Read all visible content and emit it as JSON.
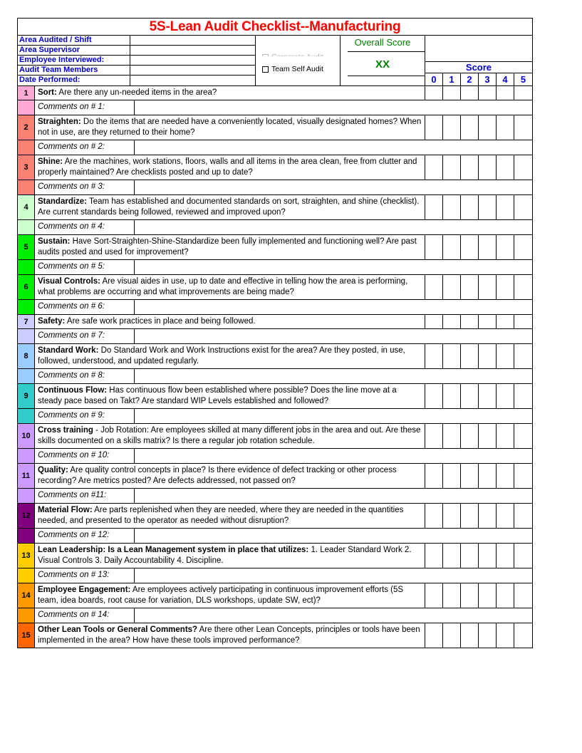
{
  "title": "5S-Lean Audit Checklist--Manufacturing",
  "header": {
    "fields": [
      {
        "label": "Area Audited / Shift",
        "value": ""
      },
      {
        "label": "Area Supervisor",
        "value": ""
      },
      {
        "label": "Employee Interviewed:",
        "value": ""
      },
      {
        "label": "Audit Team Members",
        "value": ""
      },
      {
        "label": "Date Performed:",
        "value": ""
      }
    ],
    "checkboxes": [
      {
        "label": "Corporate Audit",
        "checked": false
      },
      {
        "label": "Team Self Audit",
        "checked": false
      }
    ],
    "overall_score_label": "Overall Score",
    "overall_score_value": "XX",
    "score_word": "Score",
    "score_columns": [
      "0",
      "1",
      "2",
      "3",
      "4",
      "5"
    ]
  },
  "colors": {
    "title": "#FF0000",
    "header_label": "#0000CC",
    "score_header": "#0000CC",
    "overall_score": "#008000",
    "border": "#000000"
  },
  "items": [
    {
      "num": "1",
      "color": "#FFAAD4",
      "bold": "Sort:",
      "text": "  Are there any un-needed items in the area?",
      "comment_label": "Comments on # 1:",
      "comment_value": ""
    },
    {
      "num": "2",
      "color": "#FA8072",
      "bold": "Straighten:",
      "text": "  Do the items that are needed have a conveniently located, visually designated homes?  When not in use, are they returned to their home?",
      "comment_label": "Comments on # 2:",
      "comment_value": ""
    },
    {
      "num": "3",
      "color": "#FA8072",
      "bold": "Shine:",
      "text": "  Are the machines, work stations, floors, walls and all items in the area clean, free from clutter and properly maintained?  Are checklists posted and up to date?",
      "comment_label": "Comments on # 3:",
      "comment_value": ""
    },
    {
      "num": "4",
      "color": "#CCFFCC",
      "bold": "Standardize:",
      "text": "  Team has established and documented standards on sort, straighten, and shine (checklist).  Are current standards being followed, reviewed and improved upon?",
      "comment_label": "Comments on # 4:",
      "comment_value": ""
    },
    {
      "num": "5",
      "color": "#00EE00",
      "bold": "Sustain:",
      "text": "  Have Sort-Straighten-Shine-Standardize been fully implemented and functioning well? Are past audits posted and used for improvement?",
      "comment_label": "Comments on # 5:",
      "comment_value": ""
    },
    {
      "num": "6",
      "color": "#00EE00",
      "bold": "Visual Controls:",
      "text": " Are visual aides in use, up to date and effective in telling how the area is performing, what problems are occurring and what improvements are being made?",
      "comment_label": "Comments on # 6:",
      "comment_value": ""
    },
    {
      "num": "7",
      "color": "#CCCCFF",
      "bold": "Safety:",
      "text": "  Are safe work practices in place and being followed.",
      "comment_label": "Comments on # 7:",
      "comment_value": ""
    },
    {
      "num": "8",
      "color": "#99CCFF",
      "bold": "Standard Work:",
      "text": " Do Standard Work and Work Instructions exist for the area?  Are they posted, in use, followed, understood, and updated regularly.",
      "comment_label": "Comments on # 8:",
      "comment_value": ""
    },
    {
      "num": "9",
      "color": "#33CCCC",
      "bold": "Continuous Flow:",
      "text": " Has continuous flow been established where possible? Does the line move at a steady pace based on Takt?  Are standard WIP Levels established and followed?",
      "comment_label": "Comments on # 9:",
      "comment_value": ""
    },
    {
      "num": "10",
      "color": "#CC99FF",
      "bold": "Cross training",
      "text": " - Job Rotation: Are employees skilled at many different jobs in the area and out.  Are these skills documented on a skills matrix?  Is there a regular job rotation schedule.",
      "comment_label": "Comments on # 10:",
      "comment_value": ""
    },
    {
      "num": "11",
      "color": "#CC99FF",
      "bold": "Quality:",
      "text": " Are quality control concepts in place? Is there evidence of defect tracking or other process recording? Are metrics posted? Are defects addressed, not passed on?",
      "comment_label": "Comments on #11:",
      "comment_value": ""
    },
    {
      "num": "12",
      "color": "#800080",
      "bold": "Material Flow:",
      "text": "  Are parts replenished when they are needed, where they are needed in the quantities needed, and presented to the operator as needed without disruption?",
      "comment_label": "Comments on # 12:",
      "comment_value": ""
    },
    {
      "num": "13",
      "color": "#FFCC00",
      "bold": "Lean Leadership: Is a Lean Management system in place that utilizes:",
      "text": " 1. Leader Standard Work  2. Visual Controls 3. Daily Accountability 4. Discipline.",
      "comment_label": "Comments on # 13:",
      "comment_value": ""
    },
    {
      "num": "14",
      "color": "#FF9900",
      "bold": "Employee Engagement:",
      "text": "  Are employees actively participating in continuous improvement efforts (5S team, idea boards, root cause for variation, DLS workshops, update SW, ect)?",
      "comment_label": "Comments on # 14:",
      "comment_value": ""
    },
    {
      "num": "15",
      "color": "#FF6600",
      "bold": "Other Lean Tools or General Comments?",
      "text": " Are there other Lean Concepts, principles or tools have been implemented in the area? How have these tools improved performance?",
      "comment_label": "",
      "comment_value": ""
    }
  ]
}
